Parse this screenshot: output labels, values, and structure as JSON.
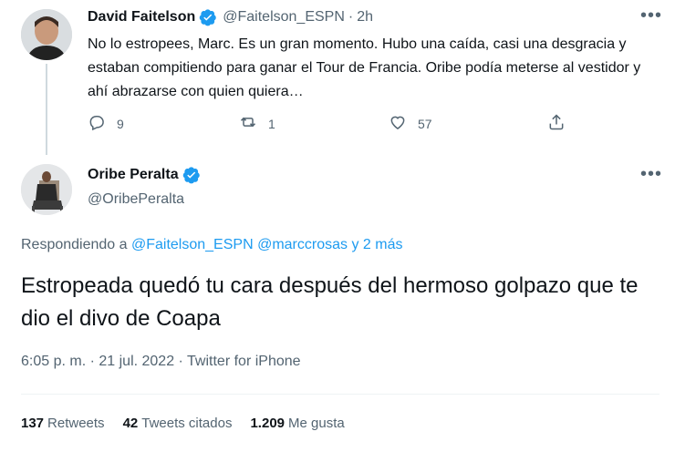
{
  "tweet1": {
    "display_name": "David Faitelson",
    "handle": "@Faitelson_ESPN",
    "separator": "·",
    "time": "2h",
    "text": "No lo estropees, Marc. Es un gran momento. Hubo una caída, casi una desgracia y estaban compitiendo para ganar el Tour de Francia. Oribe podía meterse al vestidor y ahí abrazarse con quien quiera…",
    "replies": "9",
    "retweets": "1",
    "likes": "57"
  },
  "tweet2": {
    "display_name": "Oribe Peralta",
    "handle": "@OribePeralta",
    "replying_prefix": "Respondiendo a ",
    "reply_user1": "@Faitelson_ESPN",
    "reply_user2": "@marccrosas",
    "reply_more": "y 2 más",
    "text": "Estropeada quedó tu cara después del hermoso golpazo que te dio el divo de Coapa",
    "meta": "6:05 p. m. · 21 jul. 2022 · Twitter for iPhone",
    "stats": {
      "retweets_num": "137",
      "retweets_label": "Retweets",
      "quotes_num": "42",
      "quotes_label": "Tweets citados",
      "likes_num": "1.209",
      "likes_label": "Me gusta"
    }
  },
  "icons": {
    "more": "more-icon",
    "verified": "verified-badge-icon",
    "reply": "reply-icon",
    "retweet": "retweet-icon",
    "like": "heart-icon",
    "share": "share-icon"
  },
  "colors": {
    "accent": "#1d9bf0",
    "secondary_text": "#536471",
    "primary_text": "#0f1419"
  }
}
